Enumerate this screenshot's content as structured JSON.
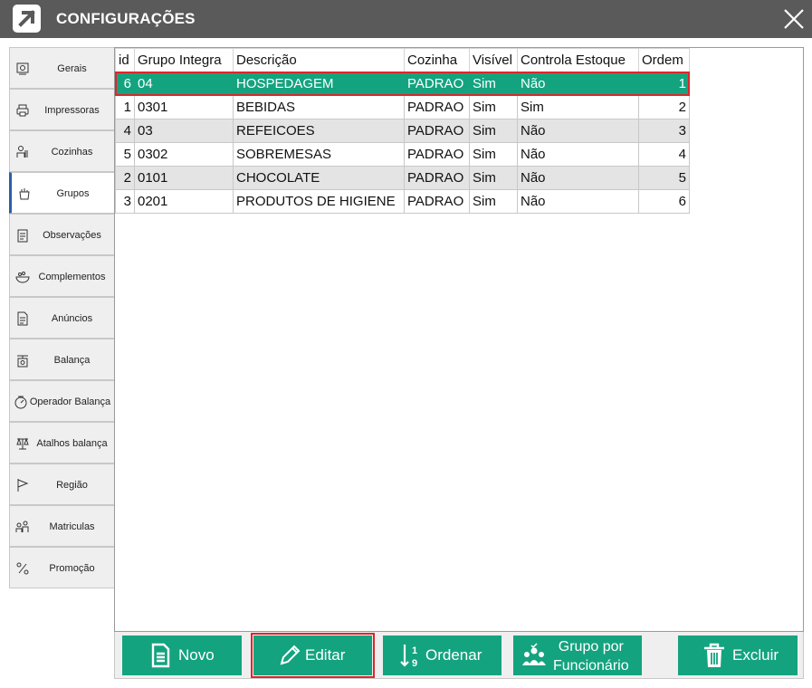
{
  "window": {
    "title": "CONFIGURAÇÕES",
    "logo_icon": "arrow-up-right-icon",
    "close_icon": "close-icon"
  },
  "sidebar": {
    "items": [
      {
        "label": "Gerais",
        "icon": "settings-panel-icon",
        "active": false
      },
      {
        "label": "Impressoras",
        "icon": "printer-icon",
        "active": false
      },
      {
        "label": "Cozinhas",
        "icon": "chef-icon",
        "active": false
      },
      {
        "label": "Grupos",
        "icon": "grocery-bag-icon",
        "active": true
      },
      {
        "label": "Observações",
        "icon": "clipboard-icon",
        "active": false
      },
      {
        "label": "Complementos",
        "icon": "food-bowl-icon",
        "active": false
      },
      {
        "label": "Anúncios",
        "icon": "document-icon",
        "active": false
      },
      {
        "label": "Balança",
        "icon": "scale-icon",
        "active": false
      },
      {
        "label": "Operador  Balança",
        "icon": "scale-operator-icon",
        "active": false
      },
      {
        "label": "Atalhos balança",
        "icon": "scale-shortcut-icon",
        "active": false
      },
      {
        "label": "Região",
        "icon": "flag-icon",
        "active": false
      },
      {
        "label": "Matriculas",
        "icon": "registration-icon",
        "active": false
      },
      {
        "label": "Promoção",
        "icon": "promotion-icon",
        "active": false
      }
    ]
  },
  "grid": {
    "columns": [
      "id",
      "Grupo Integra",
      "Descrição",
      "Cozinha",
      "Visível",
      "Controla Estoque",
      "Ordem"
    ],
    "rows": [
      [
        "6",
        "04",
        "HOSPEDAGEM",
        "PADRAO",
        "Sim",
        "Não",
        "1"
      ],
      [
        "1",
        "0301",
        "BEBIDAS",
        "PADRAO",
        "Sim",
        "Sim",
        "2"
      ],
      [
        "4",
        "03",
        "REFEICOES",
        "PADRAO",
        "Sim",
        "Não",
        "3"
      ],
      [
        "5",
        "0302",
        "SOBREMESAS",
        "PADRAO",
        "Sim",
        "Não",
        "4"
      ],
      [
        "2",
        "0101",
        "CHOCOLATE",
        "PADRAO",
        "Sim",
        "Não",
        "5"
      ],
      [
        "3",
        "0201",
        "PRODUTOS DE HIGIENE",
        "PADRAO",
        "Sim",
        "Não",
        "6"
      ]
    ],
    "selected_row": 0
  },
  "toolbar": {
    "novo": {
      "label": "Novo",
      "icon": "new-document-icon"
    },
    "editar": {
      "label": "Editar",
      "icon": "pencil-icon"
    },
    "ordenar": {
      "label": "Ordenar",
      "icon": "sort-numeric-icon"
    },
    "grupo_funcionario": {
      "line1": "Grupo por",
      "line2": "Funcionário",
      "icon": "people-group-icon"
    },
    "excluir": {
      "label": "Excluir",
      "icon": "trash-icon"
    }
  },
  "colors": {
    "accent_green": "#14a37f",
    "highlight_red": "#e0252b",
    "titlebar_gray": "#5a5a5a",
    "active_tab_blue": "#2a5fa8"
  }
}
